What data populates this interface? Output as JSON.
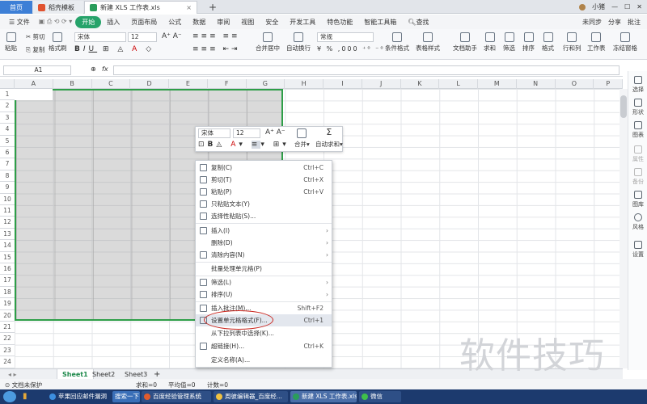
{
  "tabs": {
    "home": "首页",
    "template": "稻壳模板",
    "file": "新建 XLS 工作表.xls",
    "add": "+"
  },
  "topright": {
    "user": "小猪"
  },
  "menus": [
    "文件",
    "开始",
    "插入",
    "页面布局",
    "公式",
    "数据",
    "审阅",
    "视图",
    "安全",
    "开发工具",
    "特色功能",
    "智能工具箱",
    "查找"
  ],
  "topmenu_right": [
    "未同步",
    "分享",
    "批注"
  ],
  "ribbon": {
    "paste": "粘贴",
    "cut": "剪切",
    "copy": "复制",
    "format_painter": "格式刷",
    "font": "宋体",
    "size": "12",
    "merge": "合并居中",
    "wrap": "自动换行",
    "numfmt": "常规",
    "cond": "条件格式",
    "tablestyle": "表格样式",
    "docassist": "文档助手",
    "sum": "求和",
    "filter": "筛选",
    "sort": "排序",
    "format": "格式",
    "rowcol": "行和列",
    "sheet": "工作表",
    "freeze": "冻结窗格"
  },
  "formula": {
    "namebox": "A1",
    "fx": "fx"
  },
  "columns": [
    "A",
    "B",
    "C",
    "D",
    "E",
    "F",
    "G",
    "H",
    "I",
    "J",
    "K",
    "L",
    "M",
    "N",
    "O",
    "P"
  ],
  "rows": [
    "1",
    "2",
    "3",
    "4",
    "5",
    "6",
    "7",
    "8",
    "9",
    "10",
    "11",
    "12",
    "13",
    "14",
    "15",
    "16",
    "17",
    "18",
    "19",
    "20",
    "21",
    "22",
    "23",
    "24"
  ],
  "mini": {
    "font": "宋体",
    "size": "12",
    "merge": "合并",
    "autosum": "自动求和"
  },
  "context": [
    {
      "label": "复制(C)",
      "shortcut": "Ctrl+C"
    },
    {
      "label": "剪切(T)",
      "shortcut": "Ctrl+X"
    },
    {
      "label": "粘贴(P)",
      "shortcut": "Ctrl+V"
    },
    {
      "label": "只粘贴文本(Y)",
      "shortcut": ""
    },
    {
      "label": "选择性粘贴(S)...",
      "shortcut": ""
    },
    {
      "label": "插入(I)",
      "shortcut": ""
    },
    {
      "label": "删除(D)",
      "shortcut": ""
    },
    {
      "label": "清除内容(N)",
      "shortcut": ""
    },
    {
      "label": "批量处理单元格(P)",
      "shortcut": ""
    },
    {
      "label": "筛选(L)",
      "shortcut": ""
    },
    {
      "label": "排序(U)",
      "shortcut": ""
    },
    {
      "label": "插入批注(M)...",
      "shortcut": "Shift+F2"
    },
    {
      "label": "设置单元格格式(F)...",
      "shortcut": "Ctrl+1"
    },
    {
      "label": "从下拉列表中选择(K)...",
      "shortcut": ""
    },
    {
      "label": "超链接(H)...",
      "shortcut": "Ctrl+K"
    },
    {
      "label": "定义名称(A)...",
      "shortcut": ""
    }
  ],
  "sidebar": [
    "选择",
    "形状",
    "图表",
    "属性",
    "备份",
    "图库",
    "风格",
    "设置"
  ],
  "sheets": [
    "Sheet1",
    "Sheet2",
    "Sheet3"
  ],
  "status": {
    "protect": "文档未保护",
    "sum": "求和=0",
    "avg": "平均值=0",
    "count": "计数=0"
  },
  "taskbar": [
    "苹果回应邮件漏洞",
    "搜索一下",
    "百度经验管理系统",
    "周彼编辑器_百度经...",
    "新建 XLS 工作表.xls...",
    "微信"
  ],
  "watermark": "软件技巧",
  "colors": {
    "accent": "#26a36a",
    "selection_border": "#2e9e48",
    "highlight_circle": "#c9261f",
    "taskbar": "#1c3a6e"
  }
}
